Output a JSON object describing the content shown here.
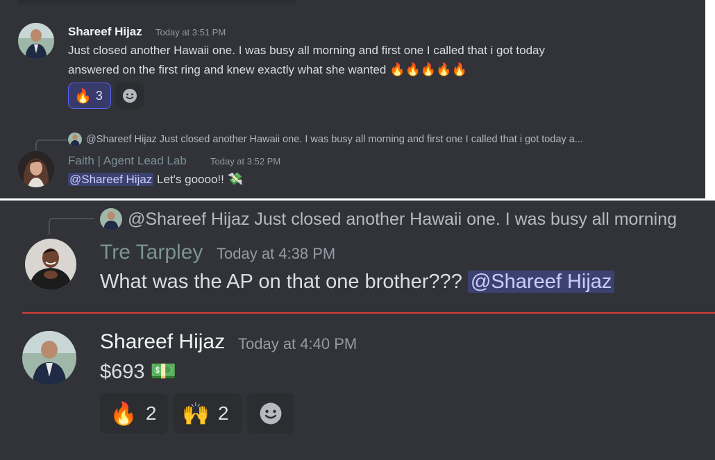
{
  "colors": {
    "background": "#313338",
    "name_default": "#f2f3f5",
    "name_faith": "#7d8f9a",
    "name_tre": "#7b9494",
    "new_divider": "#d83a3a",
    "mention_bg": "#3c4270"
  },
  "msg1": {
    "author": "Shareef Hijaz",
    "timestamp": "Today at 3:51 PM",
    "line1": "Just closed another Hawaii one. I was busy all morning and first one I called that i got today",
    "line2": "answered on the first ring and knew exactly what she wanted",
    "emojis": "🔥🔥🔥🔥🔥",
    "reaction": {
      "emoji": "🔥",
      "count": "3"
    }
  },
  "msg2": {
    "reply_preview": "@Shareef Hijaz Just closed another Hawaii one. I was busy all morning and first one I called that i got today a...",
    "author": "Faith | Agent Lead Lab",
    "timestamp": "Today at 3:52 PM",
    "mention": "@Shareef Hijaz",
    "text": "Let's goooo!!",
    "emoji": "💸"
  },
  "msg3": {
    "reply_preview": "@Shareef Hijaz Just closed another Hawaii one. I was busy all morning",
    "author": "Tre Tarpley",
    "timestamp": "Today at 4:38 PM",
    "text": "What was the AP on that one brother???",
    "mention": "@Shareef Hijaz"
  },
  "msg4": {
    "author": "Shareef Hijaz",
    "timestamp": "Today at 4:40 PM",
    "text": "$693",
    "emoji": "💵",
    "reactions": [
      {
        "emoji": "🔥",
        "count": "2"
      },
      {
        "emoji": "🙌",
        "count": "2"
      }
    ]
  },
  "icons": {
    "add_reaction": "smile-add-reaction-icon"
  }
}
